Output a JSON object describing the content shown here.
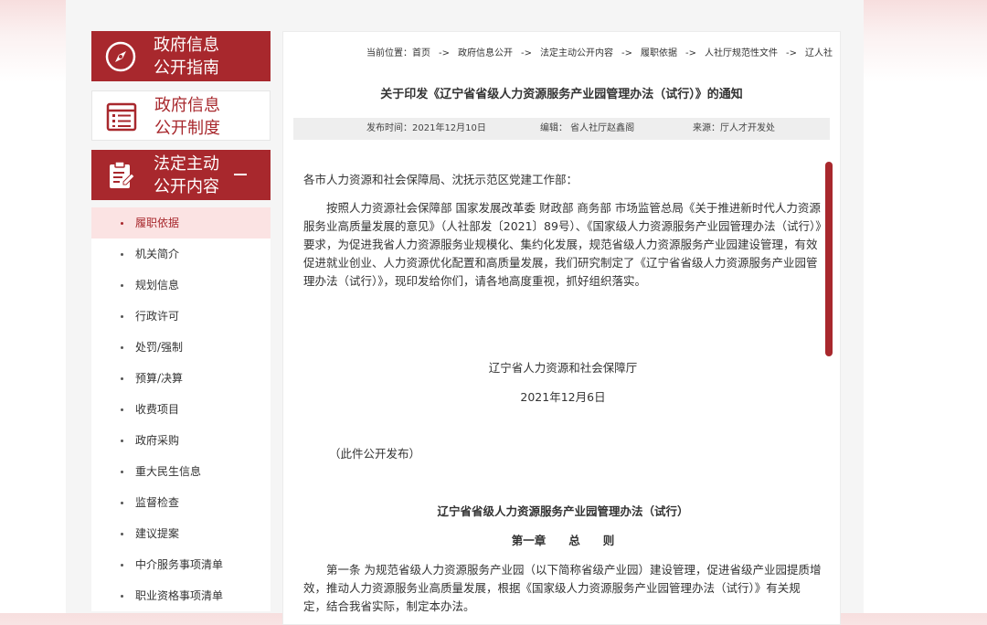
{
  "sidebar": {
    "categories": [
      {
        "label_line1": "政府信息",
        "label_line2": "公开指南",
        "icon": "compass-icon"
      },
      {
        "label_line1": "政府信息",
        "label_line2": "公开制度",
        "icon": "document-list-icon"
      },
      {
        "label_line1": "法定主动",
        "label_line2": "公开内容",
        "icon": "clipboard-edit-icon"
      }
    ],
    "items": [
      {
        "label": "履职依据",
        "active": true
      },
      {
        "label": "机关简介"
      },
      {
        "label": "规划信息"
      },
      {
        "label": "行政许可"
      },
      {
        "label": "处罚/强制"
      },
      {
        "label": "预算/决算"
      },
      {
        "label": "收费项目"
      },
      {
        "label": "政府采购"
      },
      {
        "label": "重大民生信息"
      },
      {
        "label": "监督检查"
      },
      {
        "label": "建议提案"
      },
      {
        "label": "中介服务事项清单"
      },
      {
        "label": "职业资格事项清单"
      }
    ]
  },
  "breadcrumb": {
    "prefix": "当前位置：",
    "items": [
      "首页",
      "政府信息公开",
      "法定主动公开内容",
      "履职依据",
      "人社厅规范性文件",
      "辽人社"
    ],
    "separator": "->"
  },
  "article": {
    "title": "关于印发《辽宁省省级人力资源服务产业园管理办法（试行）》的通知",
    "meta": {
      "publish": "发布时间：2021年12月10日",
      "editor": "编辑： 省人社厅赵鑫阁",
      "source": "来源：厅人才开发处"
    },
    "salutation": "各市人力资源和社会保障局、沈抚示范区党建工作部：",
    "paragraph1": "按照人力资源社会保障部 国家发展改革委 财政部 商务部 市场监管总局《关于推进新时代人力资源服务业高质量发展的意见》（人社部发〔2021〕89号）、《国家级人力资源服务产业园管理办法（试行）》要求，为促进我省人力资源服务业规模化、集约化发展，规范省级人力资源服务产业园建设管理，有效促进就业创业、人力资源优化配置和高质量发展，我们研究制定了《辽宁省省级人力资源服务产业园管理办法（试行）》，现印发给你们，请各地高度重视，抓好组织落实。",
    "signature_org": "辽宁省人力资源和社会保障厅",
    "signature_date": "2021年12月6日",
    "note": "（此件公开发布）",
    "doc_title": "辽宁省省级人力资源服务产业园管理办法（试行）",
    "chapter": "第一章　　总　　则",
    "article1": "第一条 为规范省级人力资源服务产业园（以下简称省级产业园）建设管理，促进省级产业园提质增效，推动人力资源服务业高质量发展，根据《国家级人力资源服务产业园管理办法（试行）》有关规定，结合我省实际，制定本办法。"
  },
  "colors": {
    "accent": "#a8282d",
    "active_bg": "#fbe3e3"
  }
}
